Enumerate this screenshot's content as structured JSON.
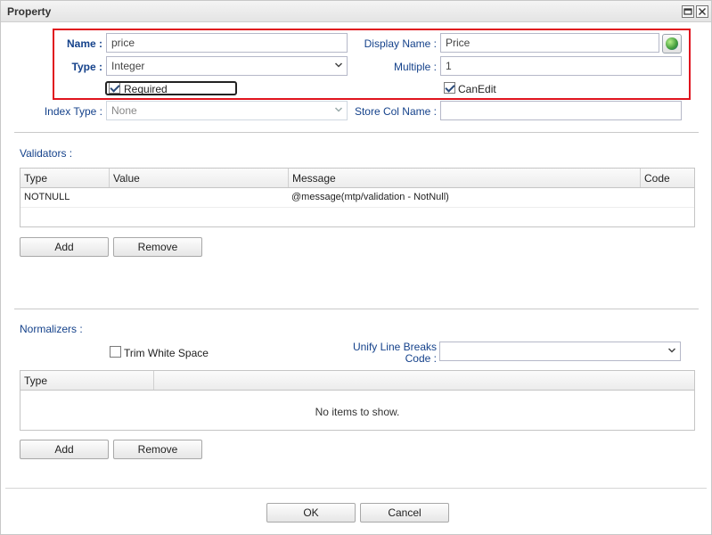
{
  "window": {
    "title": "Property",
    "max_icon": "maximize-icon",
    "close_icon": "close-icon"
  },
  "form": {
    "name_label": "Name :",
    "name_value": "price",
    "type_label": "Type :",
    "type_value": "Integer",
    "display_name_label": "Display Name :",
    "display_name_value": "Price",
    "multiple_label": "Multiple :",
    "multiple_value": "1",
    "required_label": "Required",
    "required_checked": true,
    "canedit_label": "CanEdit",
    "canedit_checked": true,
    "index_type_label": "Index Type :",
    "index_type_value": "None",
    "store_col_label": "Store Col Name :",
    "store_col_value": ""
  },
  "validators": {
    "section_label": "Validators :",
    "columns": [
      "Type",
      "Value",
      "Message",
      "Code"
    ],
    "rows": [
      {
        "type": "NOTNULL",
        "value": "",
        "message": "@message(mtp/validation - NotNull)",
        "code": ""
      }
    ],
    "add_label": "Add",
    "remove_label": "Remove"
  },
  "normalizers": {
    "section_label": "Normalizers :",
    "trim_label": "Trim White Space",
    "trim_checked": false,
    "unify_label_line1": "Unify Line Breaks",
    "unify_label_line2": "Code :",
    "unify_value": "",
    "columns": [
      "Type"
    ],
    "empty_text": "No items to show.",
    "add_label": "Add",
    "remove_label": "Remove"
  },
  "footer": {
    "ok_label": "OK",
    "cancel_label": "Cancel"
  },
  "colors": {
    "highlight": "#e0141e",
    "label": "#15428b"
  }
}
